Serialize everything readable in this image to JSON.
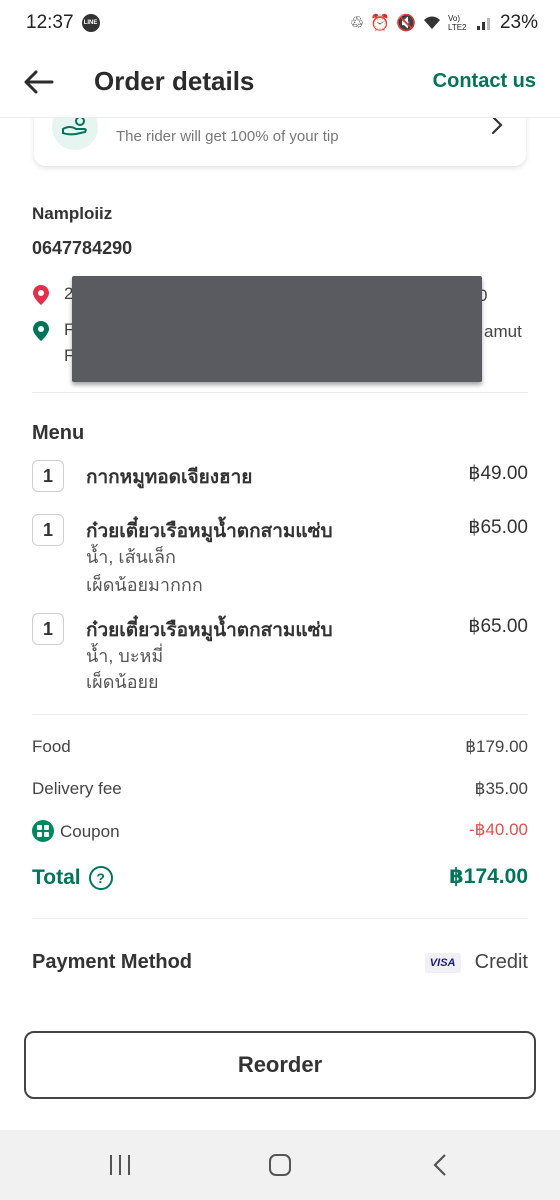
{
  "status_bar": {
    "time": "12:37",
    "battery": "23%",
    "network": "Vo) LTE2"
  },
  "header": {
    "title": "Order details",
    "contact_label": "Contact us"
  },
  "tip_card": {
    "text": "The rider will get 100% of your tip"
  },
  "customer": {
    "name": "Namploiiz",
    "phone": "0647784290",
    "address_line1_start": "2",
    "address_line1_end": "0",
    "address_line2_start": "F",
    "address_line2_end": "amut",
    "address_line3_start": "F"
  },
  "menu": {
    "heading": "Menu",
    "items": [
      {
        "qty": "1",
        "name": "กากหมูทอดเจียงฮาย",
        "price": "฿49.00",
        "options": []
      },
      {
        "qty": "1",
        "name": "ก๋วยเตี๋ยวเรือหมูน้ำตกสามแซ่บ",
        "price": "฿65.00",
        "options": [
          "น้ำ, เส้นเล็ก",
          "เผ็ดน้อยมากกก"
        ]
      },
      {
        "qty": "1",
        "name": "ก๋วยเตี๋ยวเรือหมูน้ำตกสามแซ่บ",
        "price": "฿65.00",
        "options": [
          "น้ำ, บะหมี่",
          "เผ็ดน้อยย"
        ]
      }
    ]
  },
  "summary": {
    "food_label": "Food",
    "food_value": "฿179.00",
    "delivery_label": "Delivery fee",
    "delivery_value": "฿35.00",
    "coupon_label": "Coupon",
    "coupon_value": "-฿40.00",
    "total_label": "Total",
    "total_value": "฿174.00"
  },
  "payment": {
    "label": "Payment Method",
    "card_brand": "VISA",
    "method": "Credit"
  },
  "reorder_label": "Reorder",
  "colors": {
    "accent": "#00745a",
    "negative": "#e15050",
    "pin_red": "#e0304a"
  }
}
